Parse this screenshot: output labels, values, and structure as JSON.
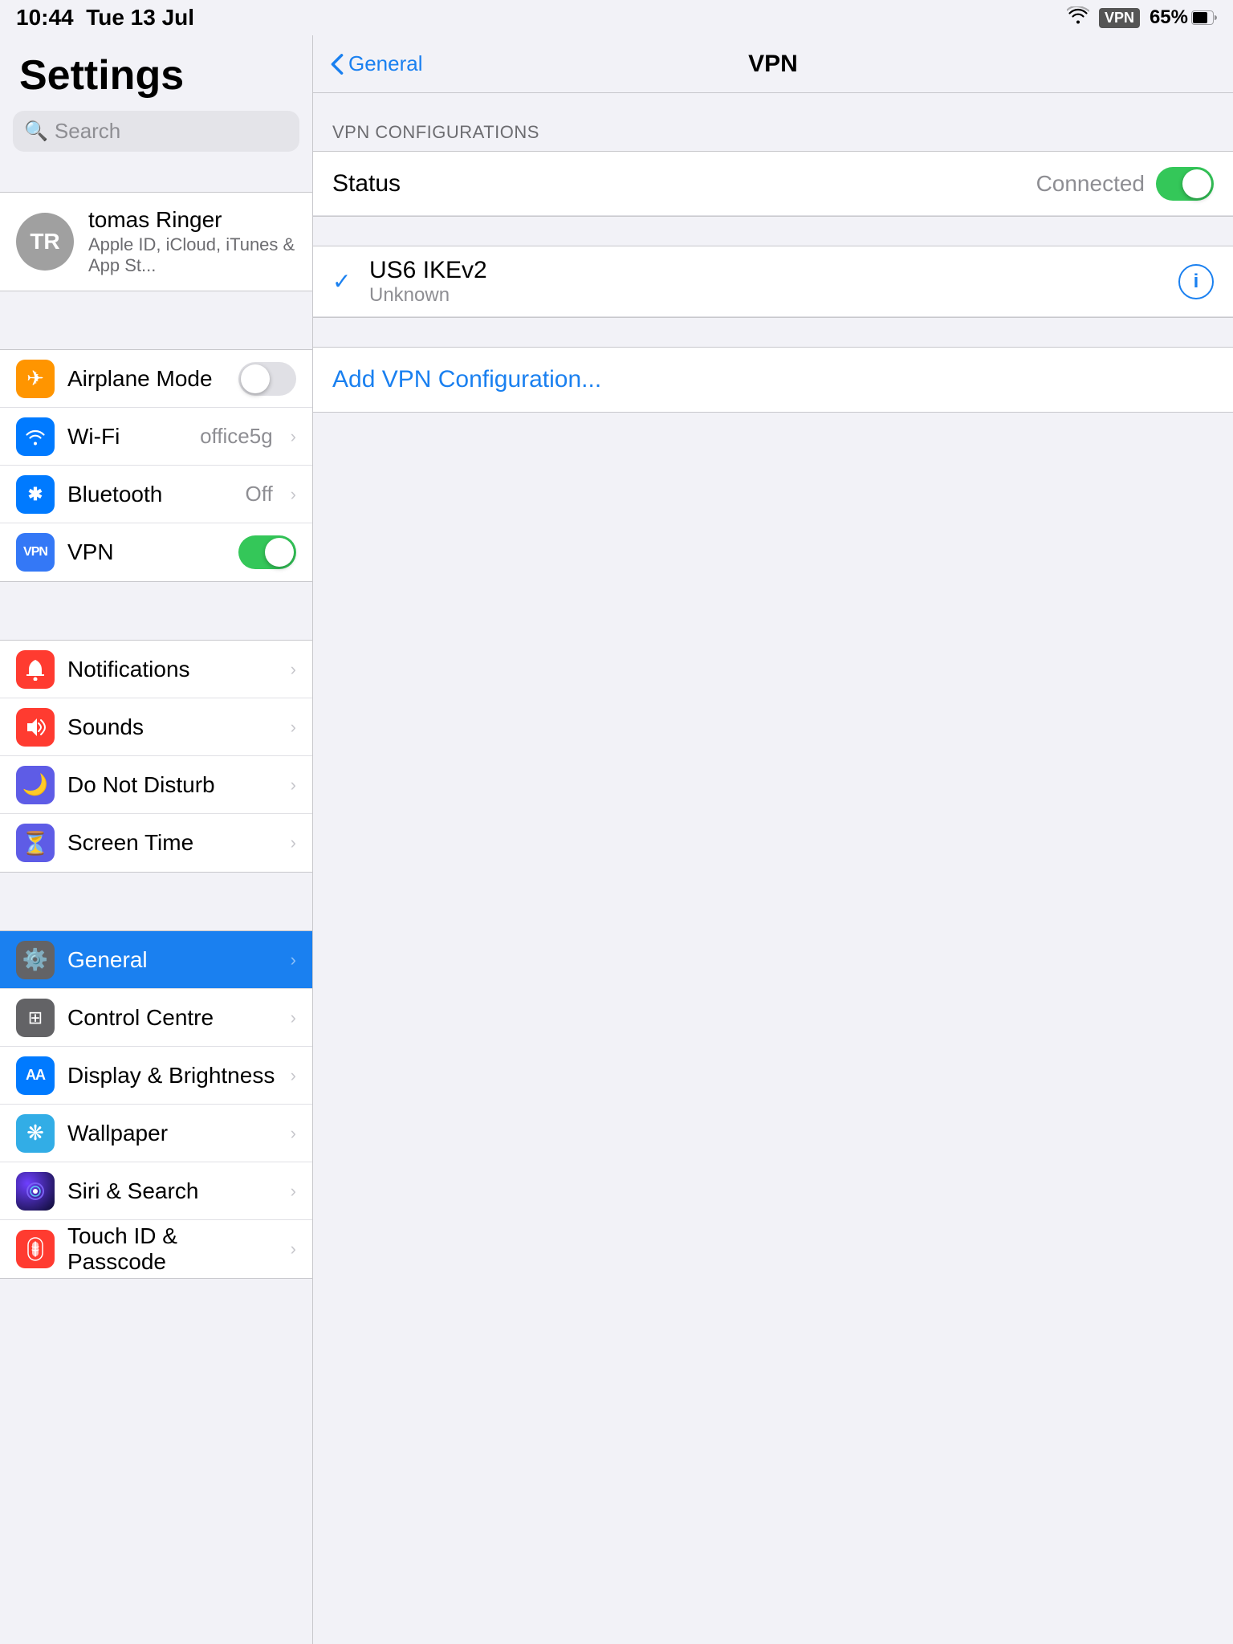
{
  "statusBar": {
    "time": "10:44",
    "date": "Tue 13 Jul",
    "wifi": "wifi",
    "vpn": "VPN",
    "battery": "65%"
  },
  "sidebar": {
    "title": "Settings",
    "search": {
      "placeholder": "Search"
    },
    "profile": {
      "initials": "TR",
      "name": "tomas Ringer",
      "subtitle": "Apple ID, iCloud, iTunes & App St..."
    },
    "group1": [
      {
        "id": "airplane-mode",
        "label": "Airplane Mode",
        "icon": "✈",
        "bg": "bg-orange",
        "toggle": "off"
      },
      {
        "id": "wifi",
        "label": "Wi-Fi",
        "icon": "📶",
        "bg": "bg-blue",
        "value": "office5g"
      },
      {
        "id": "bluetooth",
        "label": "Bluetooth",
        "icon": "🔷",
        "bg": "bg-blue-bt",
        "value": "Off"
      },
      {
        "id": "vpn",
        "label": "VPN",
        "icon": "VPN",
        "bg": "bg-blue-vpn",
        "toggle": "on"
      }
    ],
    "group2": [
      {
        "id": "notifications",
        "label": "Notifications",
        "icon": "🔴",
        "bg": "bg-red"
      },
      {
        "id": "sounds",
        "label": "Sounds",
        "icon": "🔊",
        "bg": "bg-red-sound"
      },
      {
        "id": "do-not-disturb",
        "label": "Do Not Disturb",
        "icon": "🌙",
        "bg": "bg-purple"
      },
      {
        "id": "screen-time",
        "label": "Screen Time",
        "icon": "⏳",
        "bg": "bg-purple-st"
      }
    ],
    "group3": [
      {
        "id": "general",
        "label": "General",
        "icon": "⚙️",
        "bg": "bg-gray",
        "selected": true
      },
      {
        "id": "control-centre",
        "label": "Control Centre",
        "icon": "⊞",
        "bg": "bg-gray"
      },
      {
        "id": "display",
        "label": "Display & Brightness",
        "icon": "AA",
        "bg": "bg-blue-disp"
      },
      {
        "id": "wallpaper",
        "label": "Wallpaper",
        "icon": "❋",
        "bg": "bg-cyan"
      },
      {
        "id": "siri",
        "label": "Siri & Search",
        "icon": "◉",
        "bg": "bg-dark"
      },
      {
        "id": "touchid",
        "label": "Touch ID & Passcode",
        "icon": "◎",
        "bg": "bg-red"
      }
    ]
  },
  "vpnPanel": {
    "navTitle": "VPN",
    "backLabel": "General",
    "sectionHeader": "VPN CONFIGURATIONS",
    "statusRow": {
      "label": "Status",
      "value": "Connected",
      "toggleState": "on"
    },
    "configs": [
      {
        "name": "US6 IKEv2",
        "sub": "Unknown",
        "checked": true
      }
    ],
    "addVPN": "Add VPN Configuration..."
  }
}
